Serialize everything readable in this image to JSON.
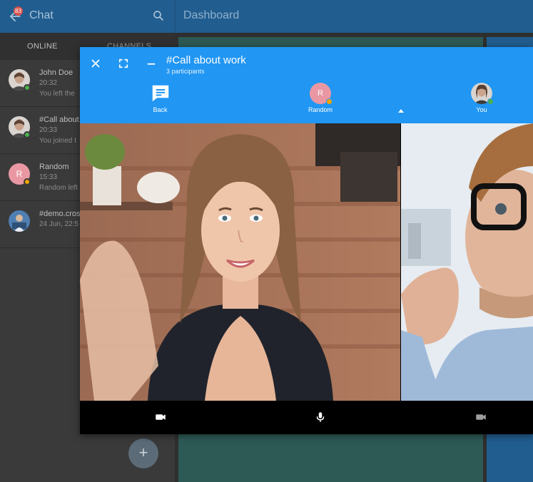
{
  "sidebar": {
    "title": "Chat",
    "badge_count": "83",
    "tabs": [
      "ONLINE",
      "CHANNELS"
    ],
    "contacts": [
      {
        "name": "John Doe",
        "time": "20:32",
        "message": "You left the",
        "status_color": "#4caf50"
      },
      {
        "name": "#Call about",
        "time": "20:33",
        "message": "You joined t",
        "status_color": "#4caf50"
      },
      {
        "name": "Random",
        "time": "15:33",
        "message": "Random left",
        "avatar_letter": "R",
        "status_color": "#f0a500"
      },
      {
        "name": "#demo.cros",
        "time": "24 Jun, 22:5",
        "message": ""
      }
    ],
    "fab_label": "+"
  },
  "dashboard": {
    "title": "Dashboard"
  },
  "call": {
    "title": "#Call about work",
    "subtitle": "3 participants",
    "participants": [
      {
        "label": "Back"
      },
      {
        "label": "Random",
        "avatar_letter": "R",
        "status_color": "#f0a500"
      },
      {
        "label": "You",
        "status_color": "#4caf50"
      }
    ]
  },
  "colors": {
    "header_blue": "#215d8f",
    "call_blue": "#2196f3",
    "sidebar_bg": "#3a3a3a"
  }
}
